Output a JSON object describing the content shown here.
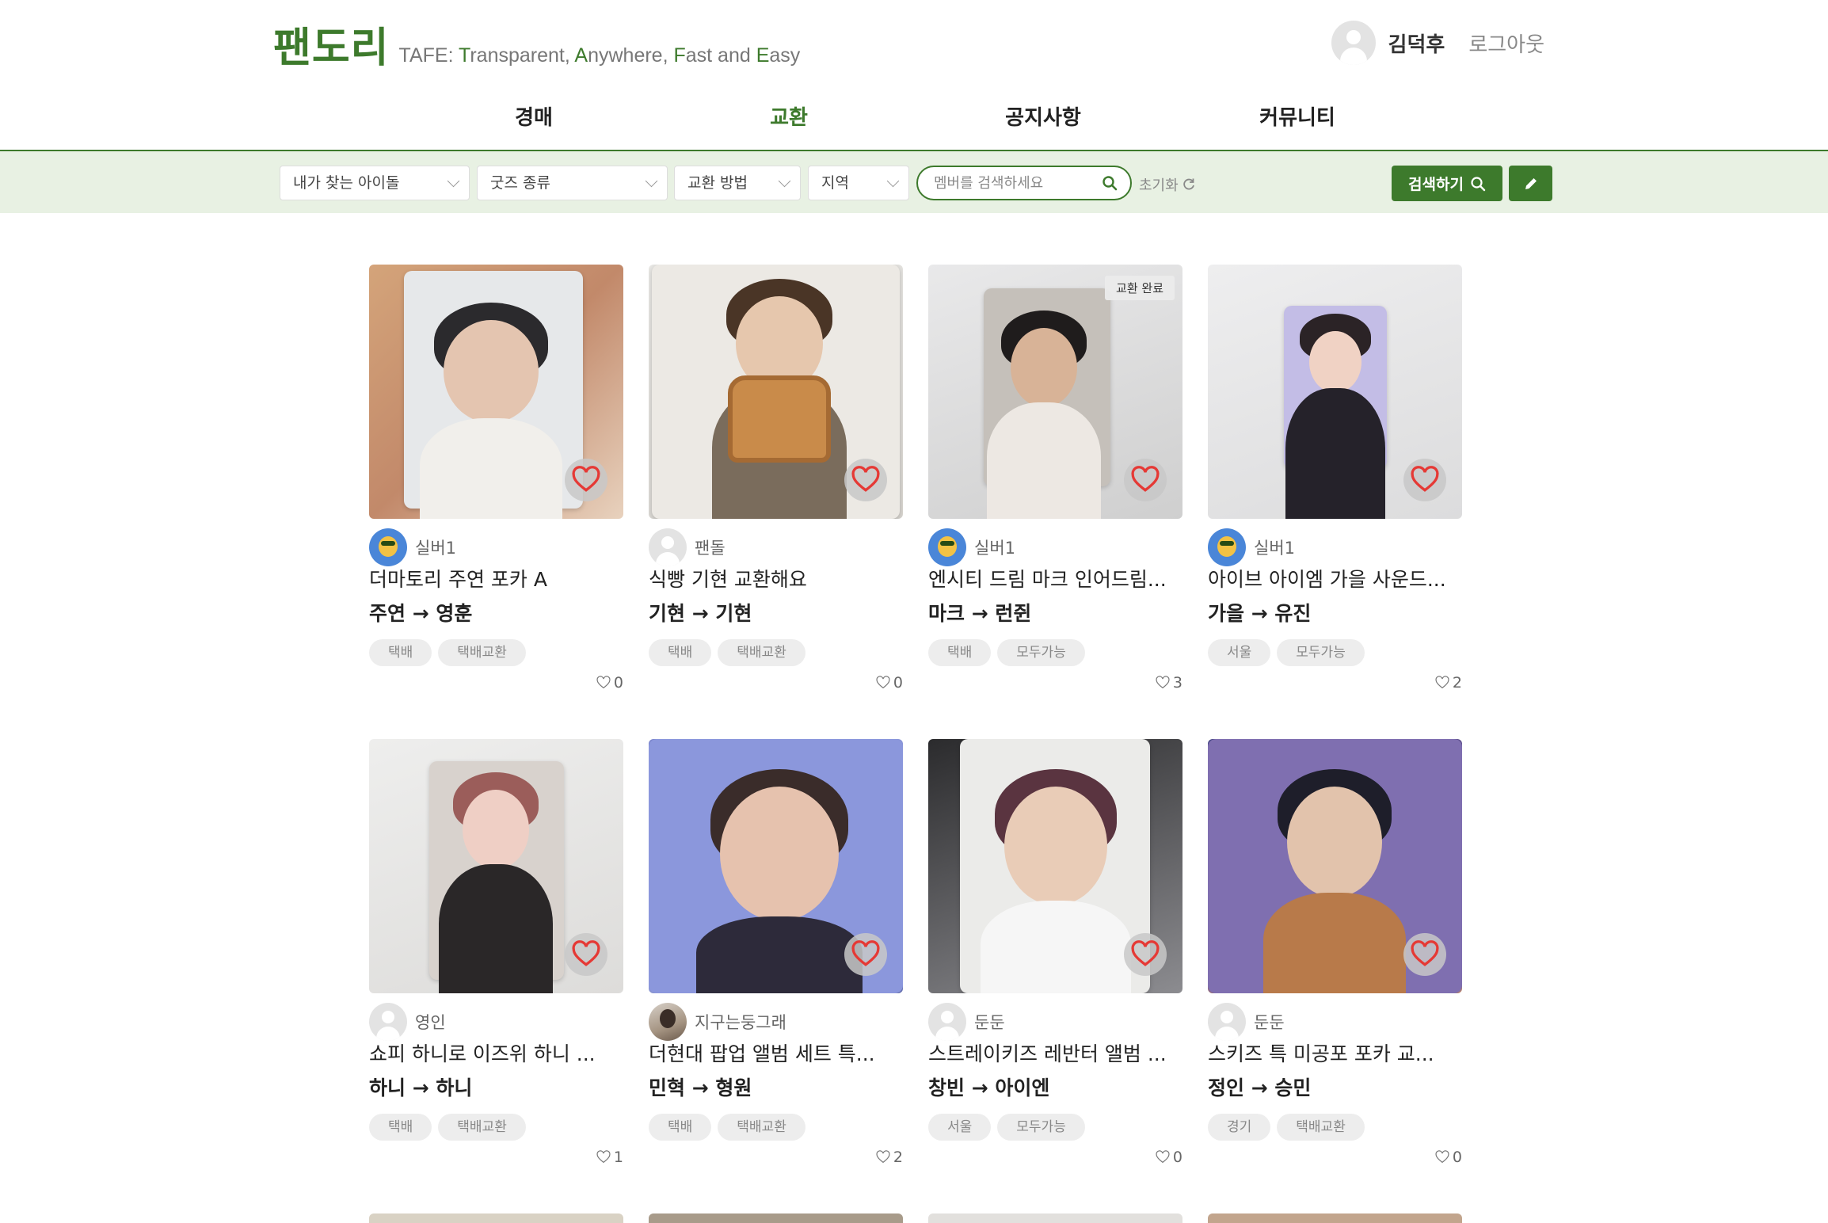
{
  "header": {
    "logo": "팬도리",
    "slogan_parts": [
      {
        "t": "TAFE: ",
        "hl": false
      },
      {
        "t": "T",
        "hl": true
      },
      {
        "t": "ransparent, ",
        "hl": false
      },
      {
        "t": "A",
        "hl": true
      },
      {
        "t": "nywhere, ",
        "hl": false
      },
      {
        "t": "F",
        "hl": true
      },
      {
        "t": "ast and ",
        "hl": false
      },
      {
        "t": "E",
        "hl": true
      },
      {
        "t": "asy",
        "hl": false
      }
    ],
    "user_name": "김덕후",
    "logout": "로그아웃"
  },
  "nav": {
    "items": [
      {
        "label": "경매",
        "active": false
      },
      {
        "label": "교환",
        "active": true
      },
      {
        "label": "공지사항",
        "active": false
      },
      {
        "label": "커뮤니티",
        "active": false
      }
    ]
  },
  "filters": {
    "idol": "내가 찾는 아이돌",
    "goods": "굿즈 종류",
    "method": "교환 방법",
    "region": "지역",
    "search_placeholder": "멤버를 검색하세요",
    "reset": "초기화",
    "search_button": "검색하기"
  },
  "colors": {
    "brand": "#3d7a2c",
    "heart": "#e53935"
  },
  "cards": [
    {
      "author": "실버1",
      "avatar": "frog",
      "title": "더마토리 주연 포카 A",
      "trade": "주연 → 영훈",
      "tags": [
        "택배",
        "택배교환"
      ],
      "likes": "0",
      "done": false
    },
    {
      "author": "팬돌",
      "avatar": "default",
      "title": "식빵 기현 교환해요",
      "trade": "기현 → 기현",
      "tags": [
        "택배",
        "택배교환"
      ],
      "likes": "0",
      "done": false
    },
    {
      "author": "실버1",
      "avatar": "frog",
      "title": "엔시티 드림 마크 인어드림...",
      "trade": "마크 → 런쥔",
      "tags": [
        "택배",
        "모두가능"
      ],
      "likes": "3",
      "done": true,
      "badge": "교환 완료"
    },
    {
      "author": "실버1",
      "avatar": "frog",
      "title": "아이브 아이엠 가을 사운드...",
      "trade": "가을 → 유진",
      "tags": [
        "서울",
        "모두가능"
      ],
      "likes": "2",
      "done": false
    },
    {
      "author": "영인",
      "avatar": "default",
      "title": "쇼피 하니로 이즈위 하니 ...",
      "trade": "하니 → 하니",
      "tags": [
        "택배",
        "택배교환"
      ],
      "likes": "1",
      "done": false
    },
    {
      "author": "지구는둥그래",
      "avatar": "photo",
      "title": "더현대 팝업 앨범 세트 특...",
      "trade": "민혁 → 형원",
      "tags": [
        "택배",
        "택배교환"
      ],
      "likes": "2",
      "done": false
    },
    {
      "author": "둔둔",
      "avatar": "default",
      "title": "스트레이키즈 레반터 앨범 ...",
      "trade": "창빈 → 아이엔",
      "tags": [
        "서울",
        "모두가능"
      ],
      "likes": "0",
      "done": false
    },
    {
      "author": "둔둔",
      "avatar": "default",
      "title": "스키즈 특 미공포 포카 교...",
      "trade": "정인 → 승민",
      "tags": [
        "경기",
        "택배교환"
      ],
      "likes": "0",
      "done": false
    }
  ]
}
